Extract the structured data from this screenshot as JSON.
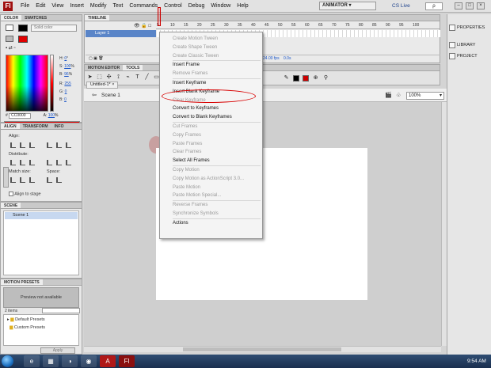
{
  "menubar": {
    "logo": "Fl",
    "items": [
      "File",
      "Edit",
      "View",
      "Insert",
      "Modify",
      "Text",
      "Commands",
      "Control",
      "Debug",
      "Window",
      "Help"
    ],
    "workspace": "ANIMATOR ▾",
    "cs_live": "CS Live",
    "search": "ρ",
    "win_buttons": [
      "–",
      "□",
      "×"
    ]
  },
  "color_panel": {
    "tabs": [
      "COLOR",
      "SWATCHES"
    ],
    "fill_type": "Solid color",
    "fields": [
      {
        "label": "H:",
        "value": "0",
        "unit": "°"
      },
      {
        "label": "S:",
        "value": "100",
        "unit": "%"
      },
      {
        "label": "B:",
        "value": "96",
        "unit": "%"
      },
      {
        "label": "R:",
        "value": "255",
        "unit": ""
      },
      {
        "label": "G:",
        "value": "0",
        "unit": ""
      },
      {
        "label": "B:",
        "value": "0",
        "unit": ""
      }
    ],
    "hex_label": "#",
    "hex": "CC0000",
    "alpha_label": "A:",
    "alpha": "100",
    "alpha_unit": "%",
    "accent": "#e00000"
  },
  "align_panel": {
    "tabs": [
      "ALIGN",
      "TRANSFORM",
      "INFO"
    ],
    "align_label": "Align:",
    "distribute_label": "Distribute:",
    "match_label": "Match size:",
    "space_label": "Space:",
    "align_to_stage": "Align to stage"
  },
  "scene_panel": {
    "tab": "SCENE",
    "rows": [
      "Scene 1"
    ]
  },
  "presets_panel": {
    "tab": "MOTION PRESETS",
    "preview": "Preview not available",
    "count": "2 items",
    "folders": [
      "Default Presets",
      "Custom Presets"
    ],
    "apply": "Apply"
  },
  "timeline": {
    "tab": "TIMELINE",
    "layer": "Layer 1",
    "ticks": [
      "5",
      "10",
      "15",
      "20",
      "25",
      "30",
      "35",
      "40",
      "45",
      "50",
      "55",
      "60",
      "65",
      "70",
      "75",
      "80",
      "85",
      "90",
      "95",
      "100"
    ],
    "fps_label": "24.00 fps",
    "frame_num": "1",
    "time_label": "0.0s"
  },
  "tools_bar": {
    "tabs": [
      "MOTION EDITOR",
      "TOOLS"
    ],
    "doc_tab": "Untitled-1* ×",
    "tools": [
      "➤",
      "⬚",
      "✣",
      "⟟",
      "⌁",
      "T",
      "╱",
      "▭",
      "✎",
      "◉",
      "⌖",
      "⬭",
      "✋",
      "⚲"
    ],
    "tools_right": [
      "✎",
      "⊕",
      "⚲"
    ]
  },
  "edit_bar": {
    "scene": "Scene 1",
    "zoom": "100%"
  },
  "right_dock": {
    "items": [
      "PROPERTIES",
      "LIBRARY",
      "PROJECT"
    ]
  },
  "context_menu": {
    "items": [
      {
        "label": "Create Motion Tween",
        "disabled": true
      },
      {
        "label": "Create Shape Tween",
        "disabled": true
      },
      {
        "label": "Create Classic Tween",
        "disabled": true
      },
      {
        "sep": true
      },
      {
        "label": "Insert Frame",
        "disabled": false
      },
      {
        "label": "Remove Frames",
        "disabled": true
      },
      {
        "sep": true
      },
      {
        "label": "Insert Keyframe",
        "disabled": false
      },
      {
        "label": "Insert Blank Keyframe",
        "disabled": false
      },
      {
        "label": "Clear Keyframe",
        "disabled": true
      },
      {
        "label": "Convert to Keyframes",
        "disabled": false
      },
      {
        "label": "Convert to Blank Keyframes",
        "disabled": false
      },
      {
        "sep": true
      },
      {
        "label": "Cut Frames",
        "disabled": true
      },
      {
        "label": "Copy Frames",
        "disabled": true
      },
      {
        "label": "Paste Frames",
        "disabled": true
      },
      {
        "label": "Clear Frames",
        "disabled": true
      },
      {
        "label": "Select All Frames",
        "disabled": false
      },
      {
        "sep": true
      },
      {
        "label": "Copy Motion",
        "disabled": true
      },
      {
        "label": "Copy Motion as ActionScript 3.0...",
        "disabled": true
      },
      {
        "label": "Paste Motion",
        "disabled": true
      },
      {
        "label": "Paste Motion Special...",
        "disabled": true
      },
      {
        "sep": true
      },
      {
        "label": "Reverse Frames",
        "disabled": true
      },
      {
        "label": "Synchronize Symbols",
        "disabled": true
      },
      {
        "sep": true
      },
      {
        "label": "Actions",
        "disabled": false
      }
    ],
    "highlight_color": "#d80000"
  },
  "taskbar": {
    "apps": [
      "e",
      "▦",
      "◑",
      "◉",
      "A",
      "Fl"
    ],
    "clock": "9:54 AM"
  }
}
